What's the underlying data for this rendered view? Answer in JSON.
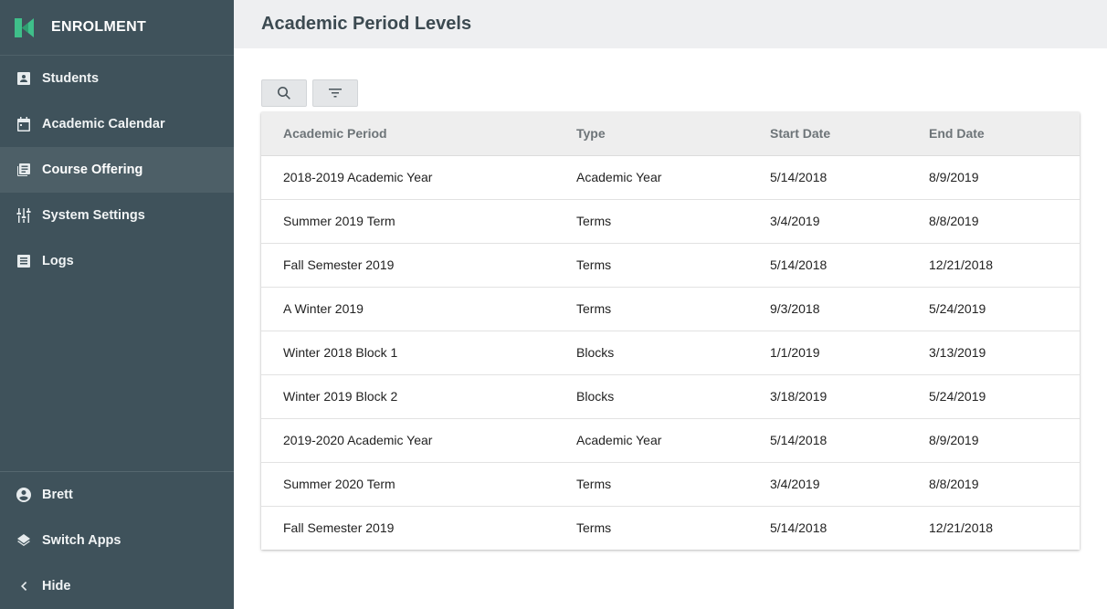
{
  "app": {
    "title": "ENROLMENT"
  },
  "sidebar": {
    "items": [
      {
        "label": "Students",
        "icon": "student-id-icon"
      },
      {
        "label": "Academic Calendar",
        "icon": "calendar-icon"
      },
      {
        "label": "Course Offering",
        "icon": "library-books-icon",
        "active": true
      },
      {
        "label": "System Settings",
        "icon": "sliders-icon"
      },
      {
        "label": "Logs",
        "icon": "list-document-icon"
      }
    ],
    "bottom": [
      {
        "label": "Brett",
        "icon": "user-circle-icon"
      },
      {
        "label": "Switch Apps",
        "icon": "layers-icon"
      },
      {
        "label": "Hide",
        "icon": "chevron-left-icon"
      }
    ]
  },
  "header": {
    "title": "Academic Period Levels"
  },
  "toolbar": {
    "search_icon": "search-icon",
    "filter_icon": "filter-icon"
  },
  "table": {
    "columns": [
      "Academic Period",
      "Type",
      "Start Date",
      "End Date"
    ],
    "rows": [
      [
        "2018-2019 Academic Year",
        "Academic Year",
        "5/14/2018",
        "8/9/2019"
      ],
      [
        "Summer 2019 Term",
        "Terms",
        "3/4/2019",
        "8/8/2019"
      ],
      [
        "Fall Semester 2019",
        "Terms",
        "5/14/2018",
        "12/21/2018"
      ],
      [
        "A Winter 2019",
        "Terms",
        "9/3/2018",
        "5/24/2019"
      ],
      [
        "Winter 2018 Block 1",
        "Blocks",
        "1/1/2019",
        "3/13/2019"
      ],
      [
        "Winter 2019 Block 2",
        "Blocks",
        "3/18/2019",
        "5/24/2019"
      ],
      [
        "2019-2020 Academic Year",
        "Academic Year",
        "5/14/2018",
        "8/9/2019"
      ],
      [
        "Summer 2020 Term",
        "Terms",
        "3/4/2019",
        "8/8/2019"
      ],
      [
        "Fall Semester 2019",
        "Terms",
        "5/14/2018",
        "12/21/2018"
      ]
    ]
  },
  "colors": {
    "sidebar": "#3f525b",
    "sidebar_active": "#4d5f67",
    "brand_accent": "#3fbf8a",
    "header_bg": "#eeeff1"
  }
}
